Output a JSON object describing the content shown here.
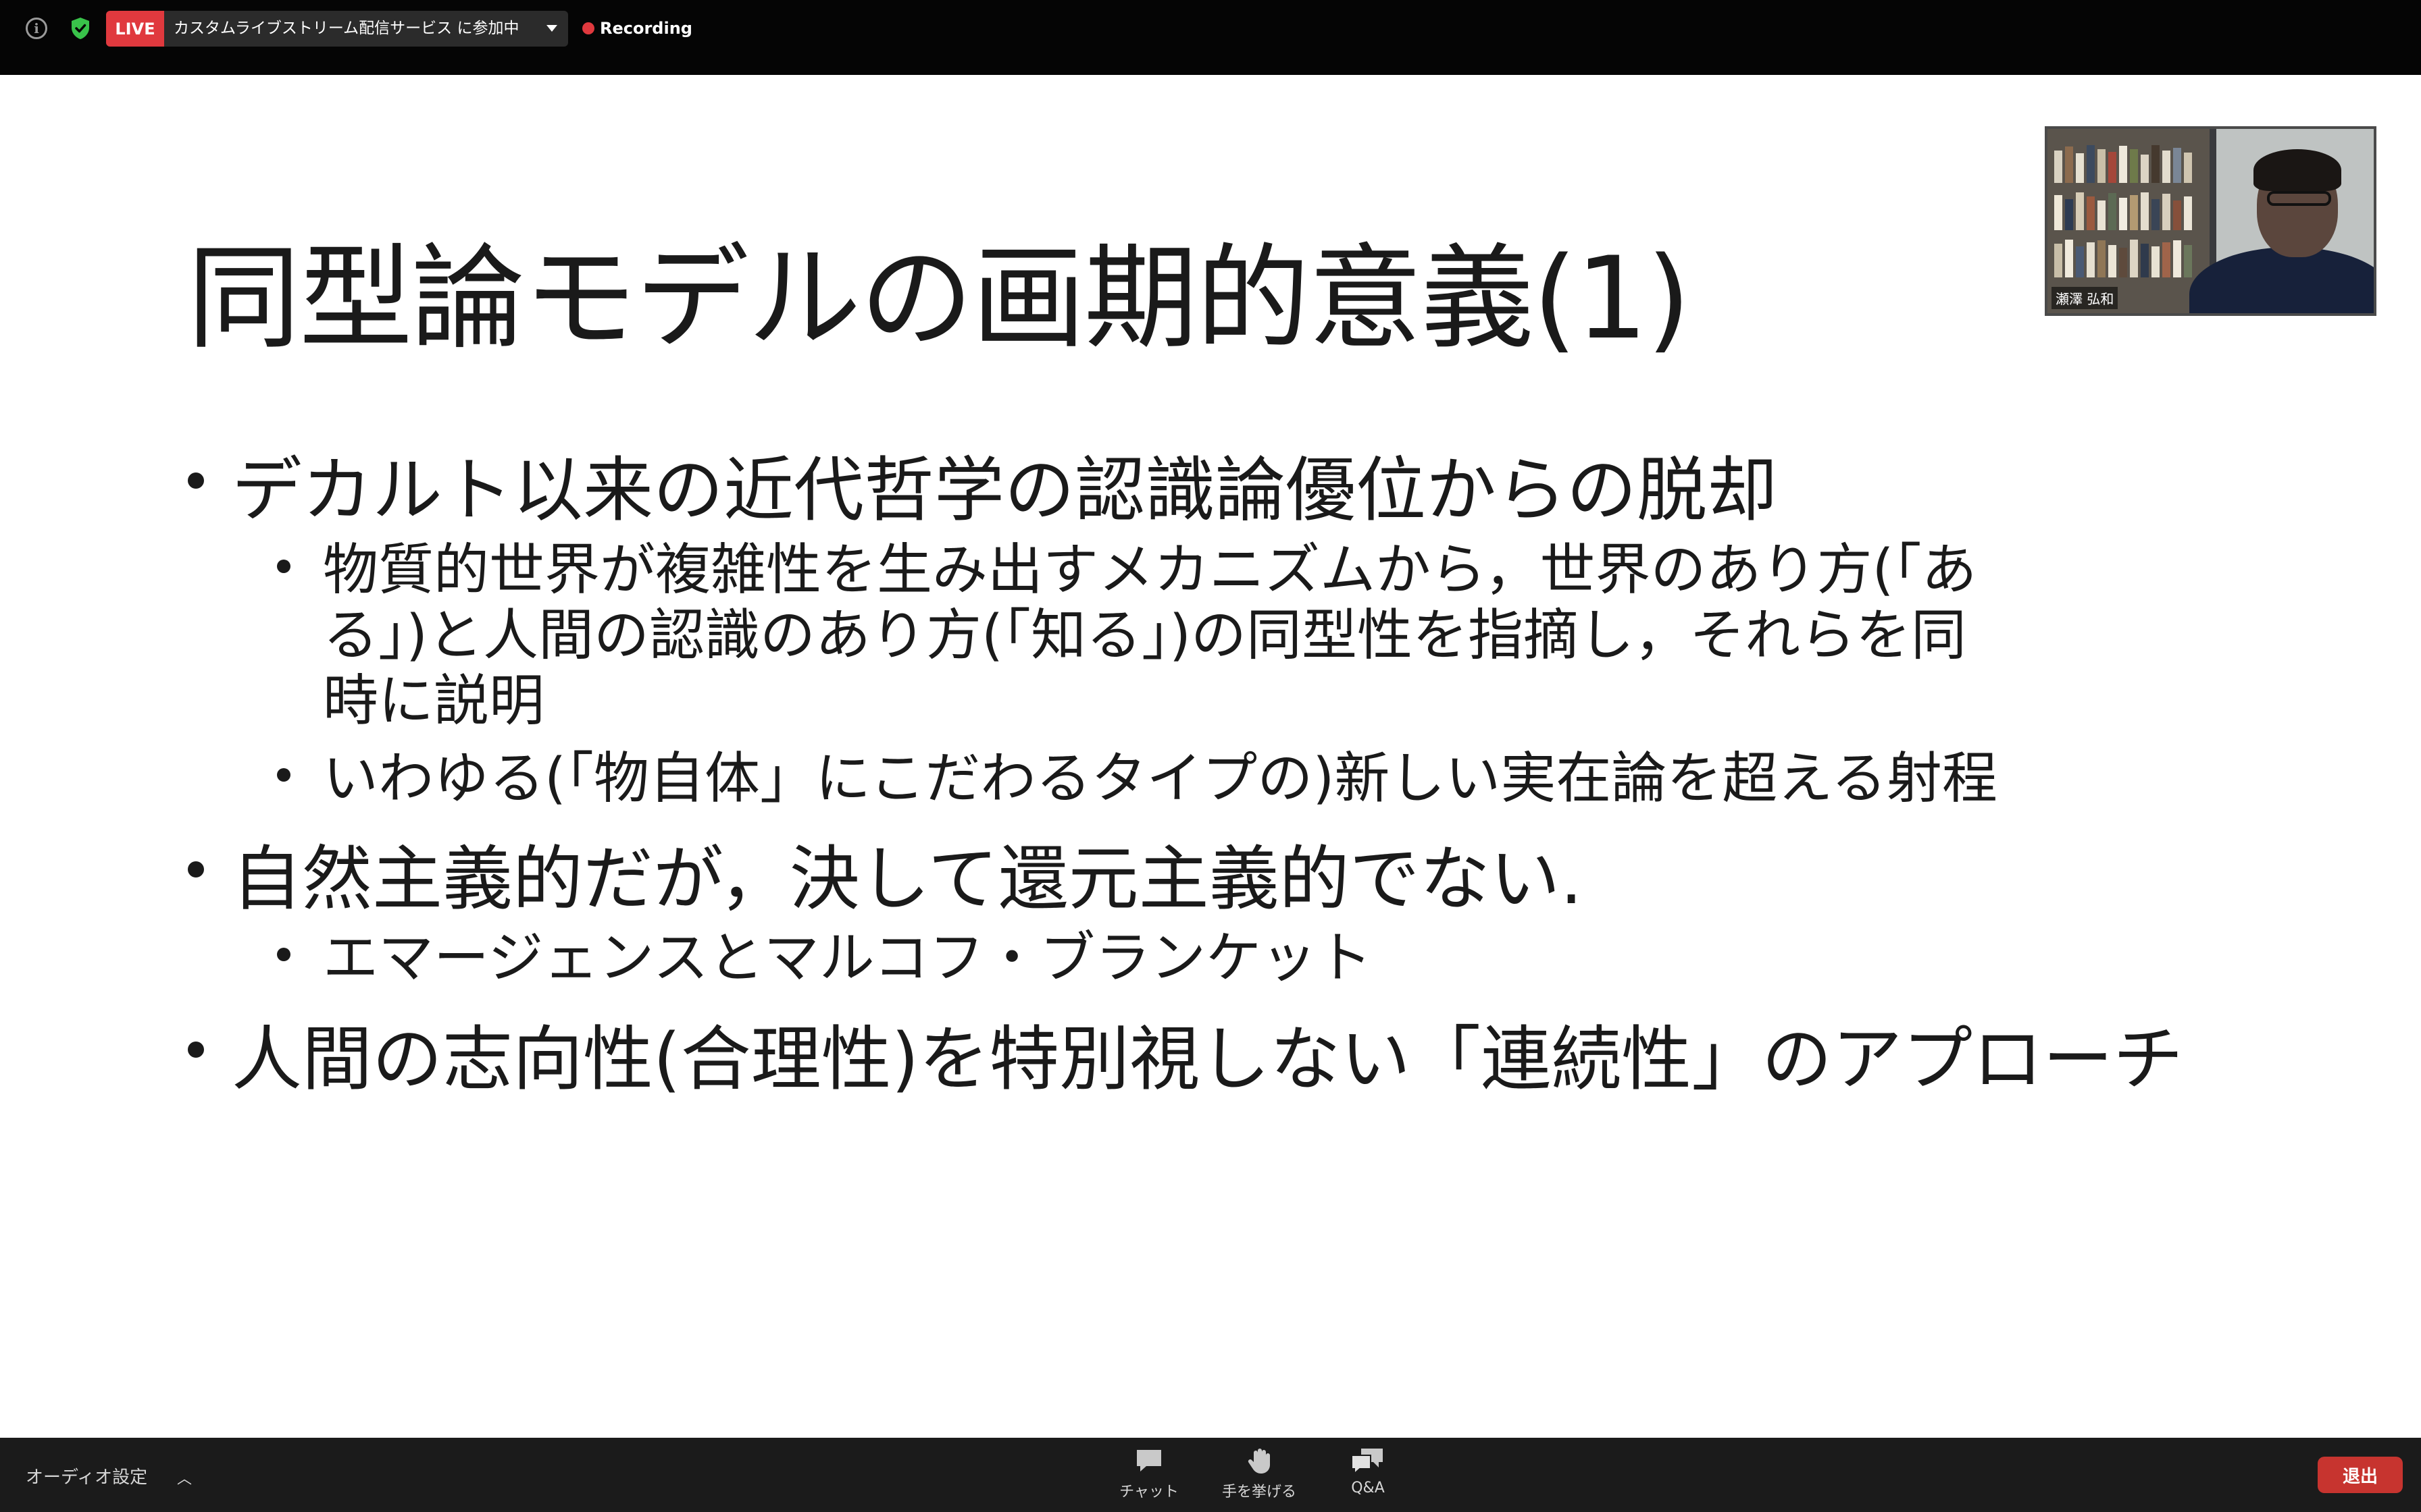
{
  "topbar": {
    "live_badge": "LIVE",
    "live_text": "カスタムライブストリーム配信サービス に参加中",
    "recording_label": "Recording"
  },
  "slide": {
    "title": "同型論モデルの画期的意義(1)",
    "bullets": [
      "デカルト以来の近代哲学の認識論優位からの脱却",
      "物質的世界が複雑性を生み出すメカニズムから，世界のあり方(「あ",
      "る」)と人間の認識のあり方(「知る」)の同型性を指摘し，それらを同",
      "時に説明",
      "いわゆる(「物自体」にこだわるタイプの)新しい実在論を超える射程",
      "自然主義的だが，決して還元主義的でない.",
      "エマージェンスとマルコフ・ブランケット",
      "人間の志向性(合理性)を特別視しない「連続性」のアプローチ"
    ]
  },
  "video": {
    "participant_name": "瀬澤 弘和"
  },
  "bottombar": {
    "audio_settings": "オーディオ設定",
    "chat": "チャット",
    "raise_hand": "手を挙げる",
    "qa": "Q&A",
    "exit": "退出"
  },
  "colors": {
    "live_red": "#e0393e",
    "exit_red": "#c7342f",
    "shield_green": "#39c24a"
  }
}
